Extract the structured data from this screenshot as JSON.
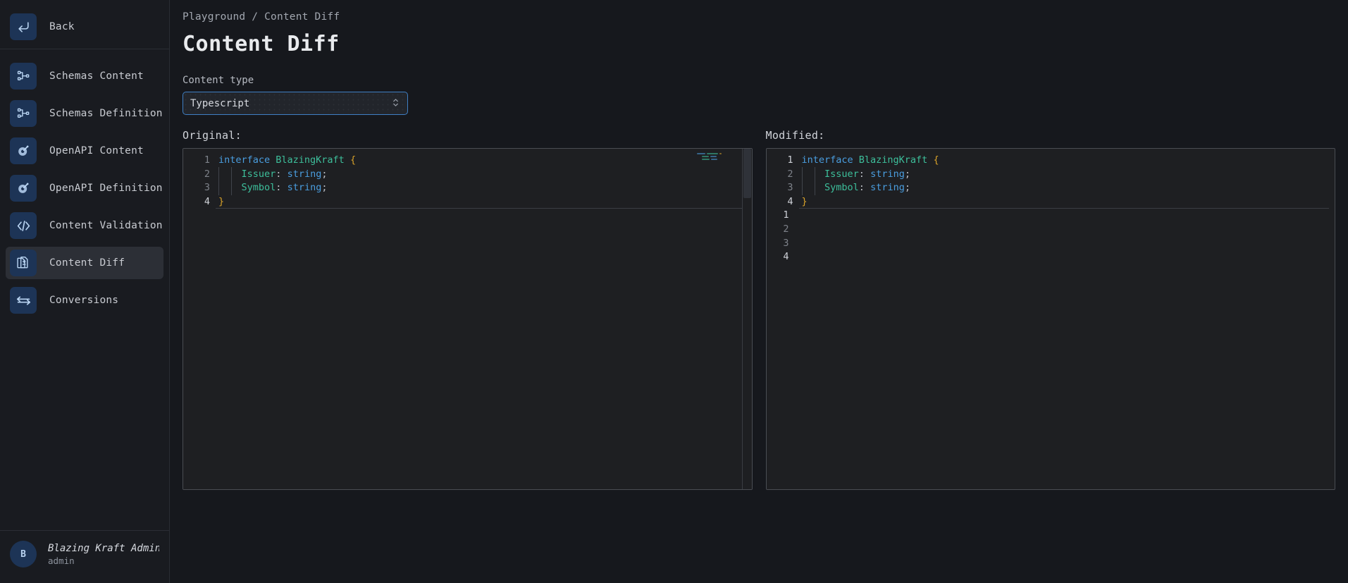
{
  "sidebar": {
    "back": {
      "label": "Back",
      "icon": "back-arrow-icon"
    },
    "items": [
      {
        "label": "Schemas Content",
        "icon": "schema-tree-icon",
        "active": false
      },
      {
        "label": "Schemas Definition",
        "icon": "schema-tree-icon",
        "active": false
      },
      {
        "label": "OpenAPI Content",
        "icon": "openapi-icon",
        "active": false
      },
      {
        "label": "OpenAPI Definition",
        "icon": "openapi-icon",
        "active": false
      },
      {
        "label": "Content Validation",
        "icon": "code-brackets-icon",
        "active": false
      },
      {
        "label": "Content Diff",
        "icon": "diff-docs-icon",
        "active": true
      },
      {
        "label": "Conversions",
        "icon": "swap-arrows-icon",
        "active": false
      }
    ],
    "user": {
      "initial": "B",
      "name": "Blazing Kraft Admin",
      "role": "admin"
    }
  },
  "header": {
    "breadcrumb": "Playground / Content Diff",
    "title": "Content Diff"
  },
  "content_type": {
    "label": "Content type",
    "value": "Typescript",
    "chevron": "chevron-updown-icon",
    "accent_color": "#3f7fc4"
  },
  "editors": {
    "original": {
      "caption": "Original:",
      "line_numbers": [
        "1",
        "2",
        "3",
        "4"
      ],
      "current_line": 4,
      "lines": [
        {
          "tokens": [
            {
              "t": "interface ",
              "c": "kw"
            },
            {
              "t": "BlazingKraft ",
              "c": "type"
            },
            {
              "t": "{",
              "c": "brace"
            }
          ]
        },
        {
          "tokens": [
            {
              "t": "    ",
              "c": "punc"
            },
            {
              "t": "Issuer",
              "c": "prop"
            },
            {
              "t": ": ",
              "c": "punc"
            },
            {
              "t": "string",
              "c": "str"
            },
            {
              "t": ";",
              "c": "punc"
            }
          ]
        },
        {
          "tokens": [
            {
              "t": "    ",
              "c": "punc"
            },
            {
              "t": "Symbol",
              "c": "prop"
            },
            {
              "t": ": ",
              "c": "punc"
            },
            {
              "t": "string",
              "c": "str"
            },
            {
              "t": ";",
              "c": "punc"
            }
          ]
        },
        {
          "tokens": [
            {
              "t": "}",
              "c": "brace"
            }
          ]
        }
      ]
    },
    "modified": {
      "caption": "Modified:",
      "line_numbers_original": [
        "1",
        "2",
        "3",
        "4"
      ],
      "line_numbers_modified": [
        "1",
        "2",
        "3",
        "4"
      ],
      "current_line": 4,
      "lines": [
        {
          "tokens": [
            {
              "t": "interface ",
              "c": "kw"
            },
            {
              "t": "BlazingKraft ",
              "c": "type"
            },
            {
              "t": "{",
              "c": "brace"
            }
          ]
        },
        {
          "tokens": [
            {
              "t": "    ",
              "c": "punc"
            },
            {
              "t": "Issuer",
              "c": "prop"
            },
            {
              "t": ": ",
              "c": "punc"
            },
            {
              "t": "string",
              "c": "str"
            },
            {
              "t": ";",
              "c": "punc"
            }
          ]
        },
        {
          "tokens": [
            {
              "t": "    ",
              "c": "punc"
            },
            {
              "t": "Symbol",
              "c": "prop"
            },
            {
              "t": ": ",
              "c": "punc"
            },
            {
              "t": "string",
              "c": "str"
            },
            {
              "t": ";",
              "c": "punc"
            }
          ]
        },
        {
          "tokens": [
            {
              "t": "}",
              "c": "brace"
            }
          ]
        }
      ]
    }
  },
  "theme": {
    "bg": "#16181d",
    "sidebar_bg": "#191b20",
    "editor_bg": "#1e1f22",
    "icon_tile": "#1d3456",
    "keyword": "#4a9ee0",
    "type": "#3dbf9b",
    "brace": "#d8a22a"
  }
}
